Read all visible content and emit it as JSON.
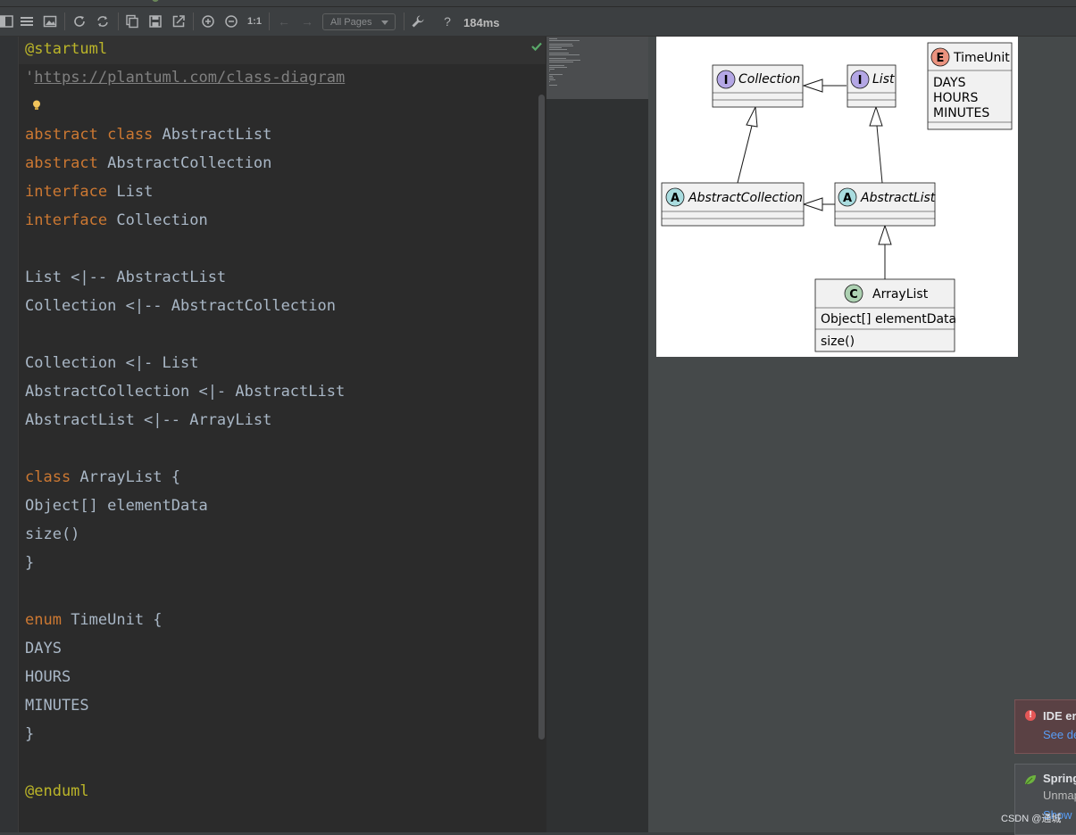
{
  "tabs": [
    {
      "label": ""
    },
    {
      "label": ""
    }
  ],
  "toolbar": {
    "pages_select": "All Pages",
    "zoom_reset": "1:1",
    "help": "?",
    "render_time": "184ms"
  },
  "editor": {
    "lines": [
      "@startuml",
      "'https://plantuml.com/class-diagram",
      "",
      "abstract class AbstractList",
      "abstract AbstractCollection",
      "interface List",
      "interface Collection",
      "",
      "List <|-- AbstractList",
      "Collection <|-- AbstractCollection",
      "",
      "Collection <|- List",
      "AbstractCollection <|- AbstractList",
      "AbstractList <|-- ArrayList",
      "",
      "class ArrayList {",
      "Object[] elementData",
      "size()",
      "}",
      "",
      "enum TimeUnit {",
      "DAYS",
      "HOURS",
      "MINUTES",
      "}",
      "",
      "@enduml"
    ]
  },
  "diagram": {
    "classes": {
      "collection": {
        "stereo": "I",
        "name": "Collection"
      },
      "list": {
        "stereo": "I",
        "name": "List"
      },
      "abstract_collection": {
        "stereo": "A",
        "name": "AbstractCollection"
      },
      "abstract_list": {
        "stereo": "A",
        "name": "AbstractList"
      },
      "array_list": {
        "stereo": "C",
        "name": "ArrayList",
        "field": "Object[] elementData",
        "method": "size()"
      },
      "time_unit": {
        "stereo": "E",
        "name": "TimeUnit",
        "values": [
          "DAYS",
          "HOURS",
          "MINUTES"
        ]
      }
    }
  },
  "notifications": {
    "error": {
      "title": "IDE er",
      "link": "See de"
    },
    "spring": {
      "title": "Spring",
      "body": "Unmap",
      "link": "Show"
    }
  },
  "watermark": "CSDN @通城",
  "colors": {
    "keyword": "#cc7832",
    "annotation": "#bbb529",
    "comment": "#808080",
    "interface_badge": "#b4a7e5",
    "abstract_badge": "#a9dcdf",
    "class_badge": "#add1b2",
    "enum_badge": "#eb937f"
  }
}
